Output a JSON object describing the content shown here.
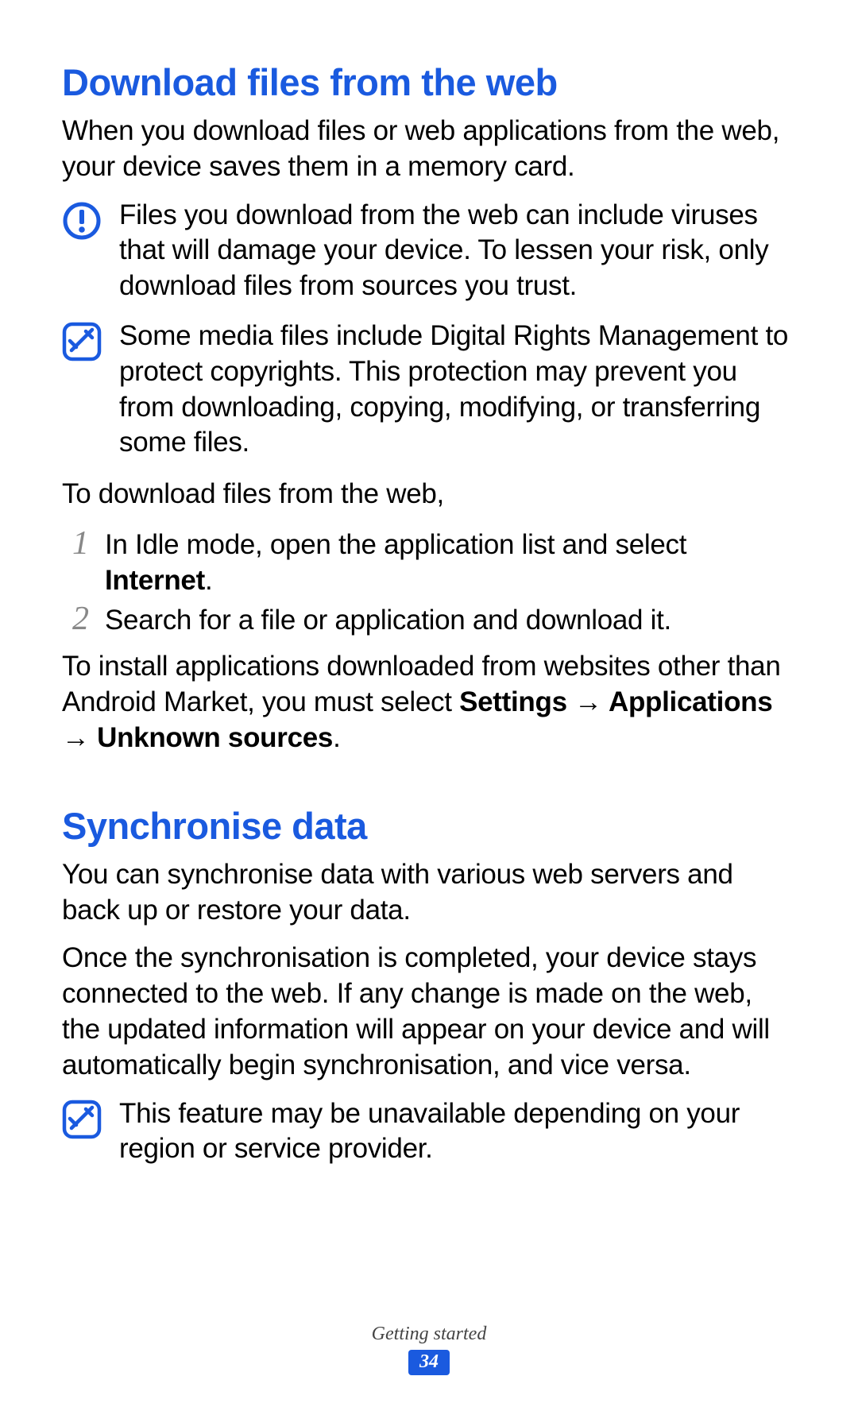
{
  "section1": {
    "heading": "Download files from the web",
    "intro": "When you download files or web applications from the web, your device saves them in a memory card.",
    "warning": "Files you download from the web can include viruses that will damage your device. To lessen your risk, only download files from sources you trust.",
    "note": "Some media files include Digital Rights Management to protect copyrights. This protection may prevent you from downloading, copying, modifying, or transferring some files.",
    "lead": "To download files from the web,",
    "steps": {
      "n1": "1",
      "t1a": "In Idle mode, open the application list and select ",
      "t1b": "Internet",
      "t1c": ".",
      "n2": "2",
      "t2": "Search for a file or application and download it."
    },
    "trail_a": "To install applications downloaded from websites other than Android Market, you must select ",
    "trail_b": "Settings",
    "trail_c": " → ",
    "trail_d": "Applications",
    "trail_e": " → ",
    "trail_f": "Unknown sources",
    "trail_g": "."
  },
  "section2": {
    "heading": "Synchronise data",
    "p1": "You can synchronise data with various web servers and back up or restore your data.",
    "p2": "Once the synchronisation is completed, your device stays connected to the web. If any change is made on the web, the updated information will appear on your device and will automatically begin synchronisation, and vice versa.",
    "note": "This feature may be unavailable depending on your region or service provider."
  },
  "footer": {
    "section_title": "Getting started",
    "page_number": "34"
  }
}
